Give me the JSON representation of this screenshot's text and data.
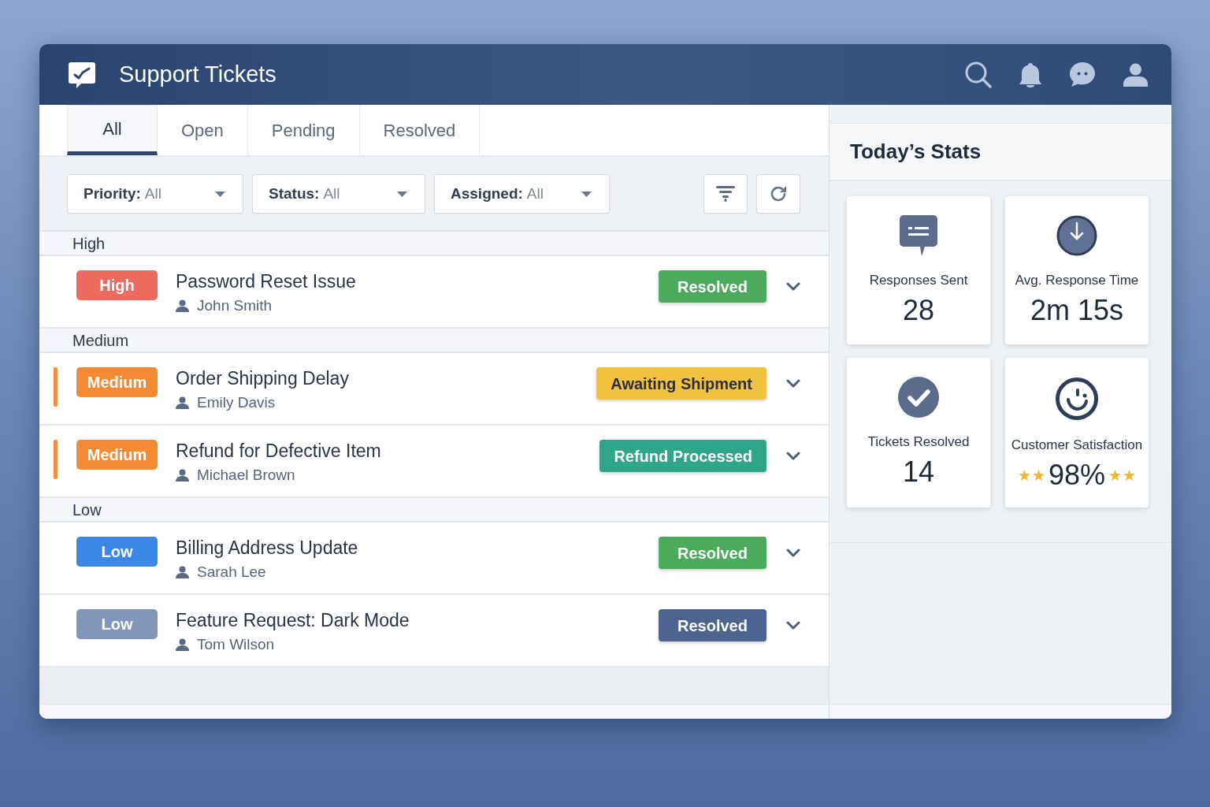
{
  "header": {
    "title": "Support Tickets"
  },
  "tabs": [
    {
      "label": "All",
      "selected": true
    },
    {
      "label": "Open",
      "selected": false
    },
    {
      "label": "Pending",
      "selected": false
    },
    {
      "label": "Resolved",
      "selected": false
    }
  ],
  "filters": [
    {
      "label": "Priority:",
      "value": "All"
    },
    {
      "label": "Status:",
      "value": "All"
    },
    {
      "label": "Assigned:",
      "value": "All"
    }
  ],
  "groups": [
    {
      "label": "High",
      "tickets": [
        {
          "title": "Password Reset Issue",
          "assignee": "John Smith",
          "flagged": false,
          "priority": {
            "text": "High",
            "color": "#ec6a5e"
          },
          "status": {
            "text": "Resolved",
            "color": "#4caa5c"
          }
        }
      ]
    },
    {
      "label": "Medium",
      "tickets": [
        {
          "title": "Order Shipping Delay",
          "assignee": "Emily Davis",
          "flagged": true,
          "priority": {
            "text": "Medium",
            "color": "#f58a34"
          },
          "status": {
            "text": "Awaiting Shipment",
            "color": "#f2c23f"
          }
        },
        {
          "title": "Refund for Defective Item",
          "assignee": "Michael Brown",
          "flagged": true,
          "priority": {
            "text": "Medium",
            "color": "#f58a34"
          },
          "status": {
            "text": "Refund Processed",
            "color": "#2fa58c"
          }
        }
      ]
    },
    {
      "label": "Low",
      "tickets": [
        {
          "title": "Billing Address Update",
          "assignee": "Sarah Lee",
          "flagged": false,
          "priority": {
            "text": "Low",
            "color": "#3b87e8"
          },
          "status": {
            "text": "Resolved",
            "color": "#4caa5c"
          }
        },
        {
          "title": "Feature Request: Dark Mode",
          "assignee": "Tom Wilson",
          "flagged": false,
          "priority": {
            "text": "Low",
            "color": "#8296bb"
          },
          "status": {
            "text": "Resolved",
            "color": "#4d6491"
          }
        }
      ]
    }
  ],
  "stats": {
    "title": "Today’s Stats",
    "cards": [
      {
        "label": "Responses Sent",
        "value": "28"
      },
      {
        "label": "Avg. Response Time",
        "value": "2m 15s"
      },
      {
        "label": "Tickets Resolved",
        "value": "14"
      },
      {
        "label": "Customer Satisfaction",
        "value": "98%",
        "stars": 4
      }
    ]
  }
}
